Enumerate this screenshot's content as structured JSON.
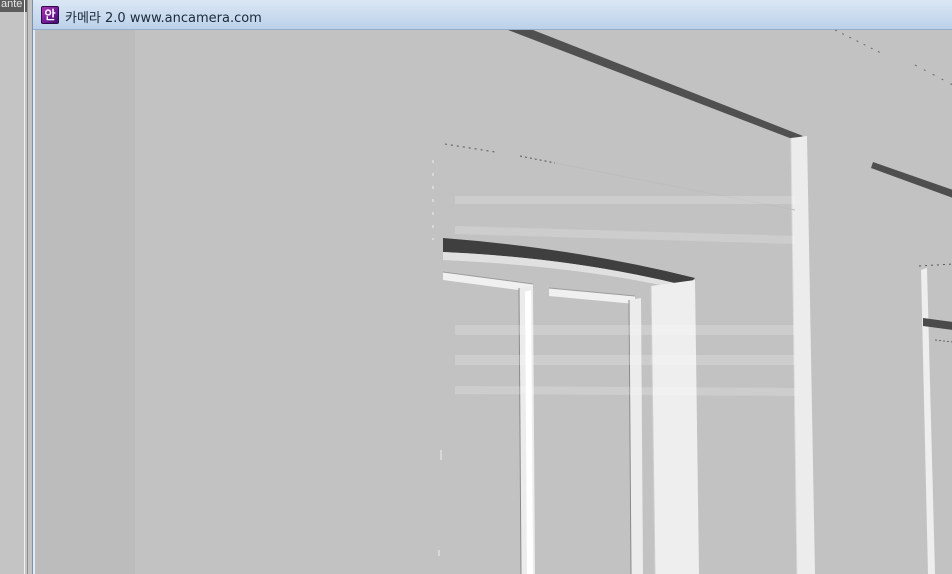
{
  "background_window": {
    "tab_label": "ante"
  },
  "camera_window": {
    "icon_glyph": "안",
    "title": "카메라 2.0 www.ancamera.com"
  },
  "viewport": {
    "description_icon": "camera-view",
    "colors": {
      "wall": "#c2c2c2",
      "door_face": "#ececec",
      "dark_edge": "#4a4a4a"
    }
  }
}
